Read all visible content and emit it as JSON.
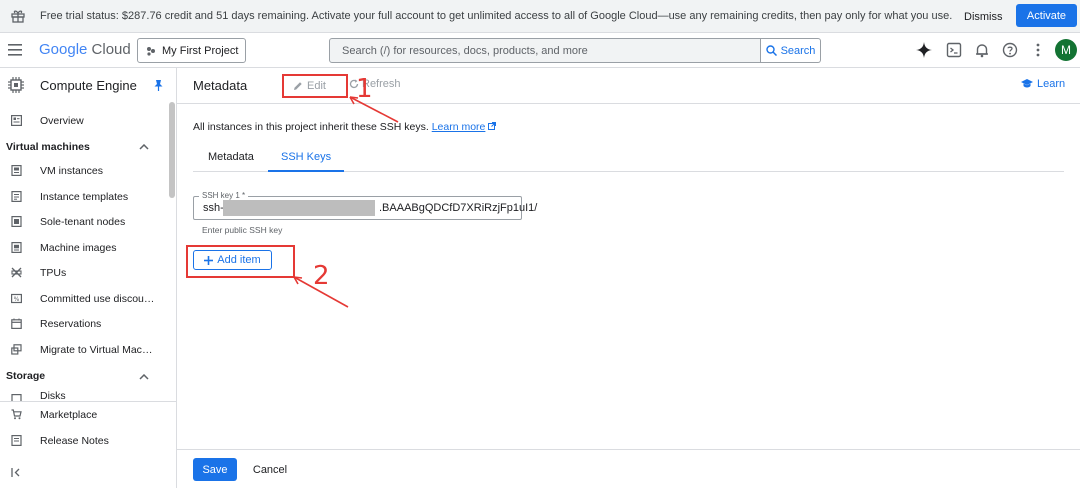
{
  "banner": {
    "message": "Free trial status: $287.76 credit and 51 days remaining. Activate your full account to get unlimited access to all of Google Cloud—use any remaining credits, then pay only for what you use.",
    "dismiss_label": "Dismiss",
    "activate_label": "Activate"
  },
  "topbar": {
    "logo_word1": "Google",
    "logo_word2": "Cloud",
    "project_label": "My First Project",
    "search_placeholder": "Search (/) for resources, docs, products, and more",
    "search_button": "Search",
    "avatar_initial": "M"
  },
  "sidebar": {
    "title": "Compute Engine",
    "overview": "Overview",
    "section_vm": "Virtual machines",
    "items": [
      {
        "label": "VM instances",
        "icon": "vm-icon"
      },
      {
        "label": "Instance templates",
        "icon": "template-icon"
      },
      {
        "label": "Sole-tenant nodes",
        "icon": "node-icon"
      },
      {
        "label": "Machine images",
        "icon": "image-icon"
      },
      {
        "label": "TPUs",
        "icon": "tpu-icon"
      },
      {
        "label": "Committed use discou…",
        "icon": "discount-icon"
      },
      {
        "label": "Reservations",
        "icon": "calendar-icon"
      },
      {
        "label": "Migrate to Virtual Mach…",
        "icon": "migrate-icon"
      }
    ],
    "section_storage": "Storage",
    "disks": "Disks",
    "marketplace": "Marketplace",
    "release_notes": "Release Notes"
  },
  "main": {
    "title": "Metadata",
    "edit_label": "Edit",
    "refresh_label": "Refresh",
    "learn_label": "Learn",
    "inherit_text": "All instances in this project inherit these SSH keys.",
    "learn_more": "Learn more",
    "tabs": [
      "Metadata",
      "SSH Keys"
    ],
    "field_label": "SSH key 1 *",
    "field_prefix": "ssh-",
    "field_suffix": ".BAAABgQDCfD7XRiRzjFp1uI1/",
    "hint": "Enter public SSH key",
    "add_item": "Add item",
    "save": "Save",
    "cancel": "Cancel"
  },
  "annotations": {
    "one": "1",
    "two": "2",
    "color": "#e53935"
  }
}
